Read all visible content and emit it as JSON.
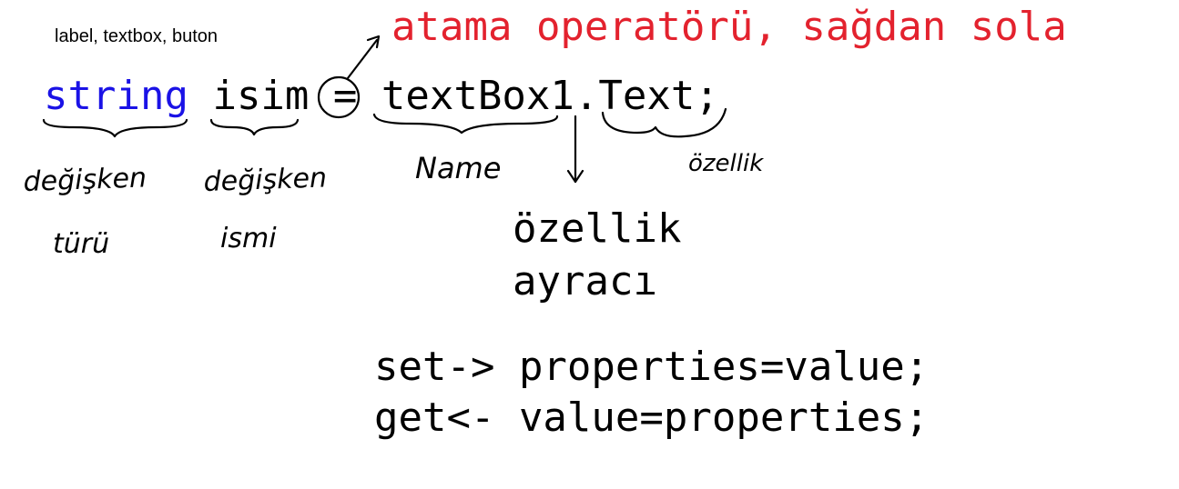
{
  "labels": {
    "controls_note": "label, textbox, buton",
    "assignment_note": "atama operatörü, sağdan sola"
  },
  "code": {
    "type": "string",
    "variable": "isim",
    "operator": "=",
    "object": "textBox1",
    "dot": ".",
    "property": "Text;"
  },
  "handwritten": {
    "variable_type_line1": "değişken",
    "variable_type_line2": "türü",
    "variable_name_line1": "değişken",
    "variable_name_line2": "ismi",
    "name": "Name",
    "property": "özellik"
  },
  "separator": {
    "line1": "özellik",
    "line2": "ayracı"
  },
  "accessors": {
    "set": "set-> properties=value;",
    "get": "get<- value=properties;"
  },
  "colors": {
    "keyword": "#1a12e6",
    "heading": "#e3222e",
    "text": "#000000"
  }
}
